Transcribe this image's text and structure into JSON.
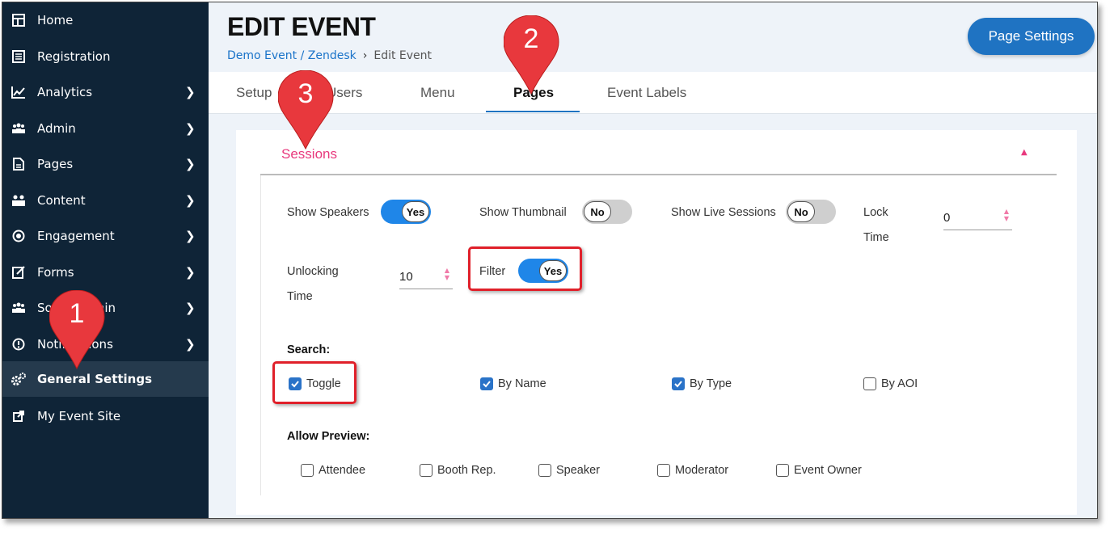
{
  "sidebar": {
    "items": [
      {
        "label": "Home",
        "icon": "dashboard-icon",
        "chevron": false,
        "active": false
      },
      {
        "label": "Registration",
        "icon": "registration-icon",
        "chevron": false,
        "active": false
      },
      {
        "label": "Analytics",
        "icon": "chart-icon",
        "chevron": true,
        "active": false
      },
      {
        "label": "Admin",
        "icon": "users-icon",
        "chevron": true,
        "active": false
      },
      {
        "label": "Pages",
        "icon": "page-icon",
        "chevron": true,
        "active": false
      },
      {
        "label": "Content",
        "icon": "people-icon",
        "chevron": true,
        "active": false
      },
      {
        "label": "Engagement",
        "icon": "target-icon",
        "chevron": true,
        "active": false
      },
      {
        "label": "Forms",
        "icon": "form-edit-icon",
        "chevron": true,
        "active": false
      },
      {
        "label": "Social Admin",
        "icon": "social-users-icon",
        "chevron": true,
        "active": false
      },
      {
        "label": "Notifications",
        "icon": "alert-icon",
        "chevron": true,
        "active": false
      },
      {
        "label": "General Settings",
        "icon": "gears-icon",
        "chevron": false,
        "active": true
      },
      {
        "label": "My Event Site",
        "icon": "external-link-icon",
        "chevron": false,
        "active": false
      }
    ]
  },
  "header": {
    "title": "EDIT EVENT",
    "breadcrumb_link": "Demo Event / Zendesk",
    "breadcrumb_sep": "›",
    "breadcrumb_current": "Edit Event",
    "page_settings_label": "Page Settings"
  },
  "tabs": [
    {
      "label": "Setup",
      "active": false
    },
    {
      "label": "Users",
      "active": false
    },
    {
      "label": "Menu",
      "active": false
    },
    {
      "label": "Pages",
      "active": true
    },
    {
      "label": "Event Labels",
      "active": false
    }
  ],
  "sessions": {
    "title": "Sessions",
    "show_speakers": {
      "label": "Show Speakers",
      "value": "Yes",
      "on": true
    },
    "show_thumbnail": {
      "label": "Show Thumbnail",
      "value": "No",
      "on": false
    },
    "show_live_sessions": {
      "label": "Show Live Sessions",
      "value": "No",
      "on": false
    },
    "lock_time": {
      "label_line1": "Lock",
      "label_line2": "Time",
      "value": "0"
    },
    "unlocking_time": {
      "label_line1": "Unlocking",
      "label_line2": "Time",
      "value": "10"
    },
    "filter": {
      "label": "Filter",
      "value": "Yes",
      "on": true
    },
    "search": {
      "heading": "Search:",
      "options": [
        {
          "label": "Toggle",
          "checked": true
        },
        {
          "label": "By Name",
          "checked": true
        },
        {
          "label": "By Type",
          "checked": true
        },
        {
          "label": "By AOI",
          "checked": false
        }
      ]
    },
    "allow_preview": {
      "heading": "Allow Preview:",
      "options": [
        {
          "label": "Attendee",
          "checked": false
        },
        {
          "label": "Booth Rep.",
          "checked": false
        },
        {
          "label": "Speaker",
          "checked": false
        },
        {
          "label": "Moderator",
          "checked": false
        },
        {
          "label": "Event Owner",
          "checked": false
        }
      ]
    }
  },
  "annotations": {
    "step1": "1",
    "step2": "2",
    "step3": "3",
    "highlight_color": "#e0202a"
  },
  "colors": {
    "sidebar_bg": "#0f2437",
    "accent_blue": "#1f73c2",
    "section_title_pink": "#e8397d"
  }
}
